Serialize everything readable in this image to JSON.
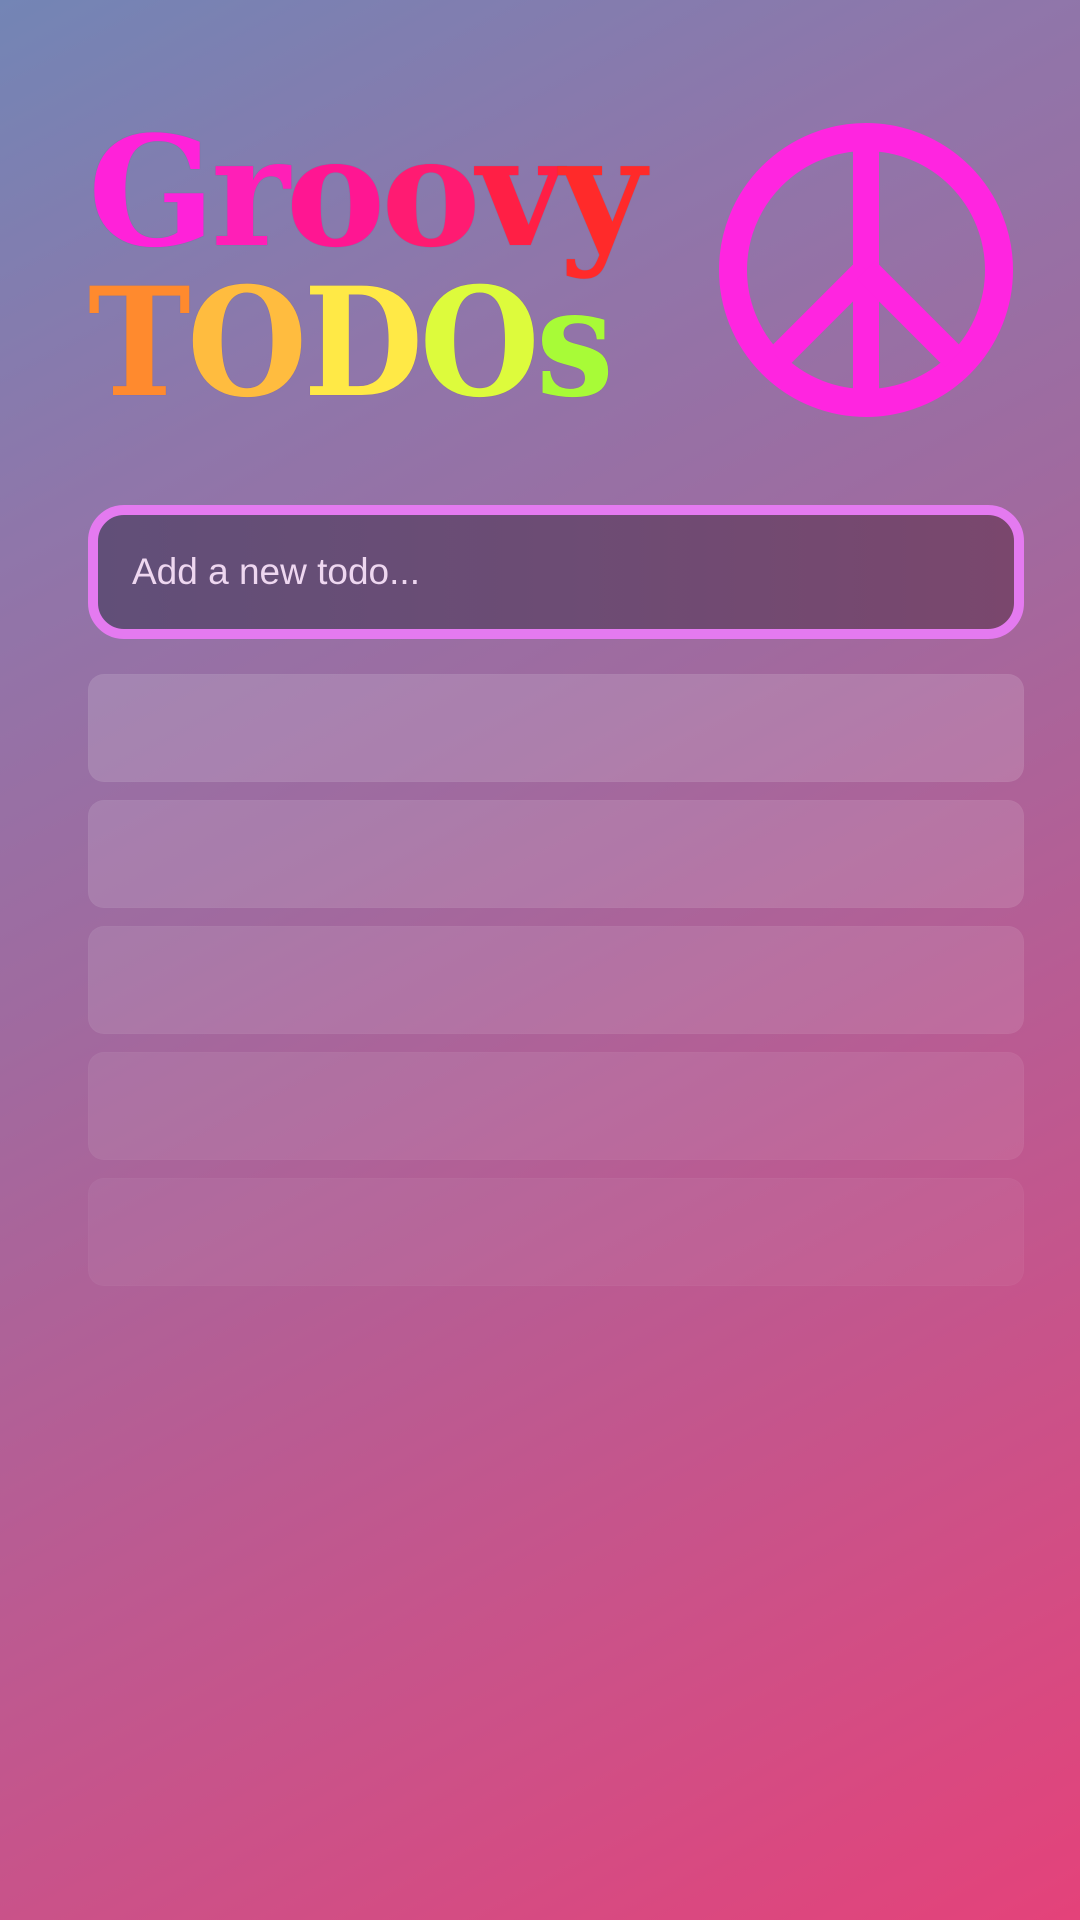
{
  "header": {
    "title_line_1": [
      {
        "char": "G",
        "color": "#ff22d9"
      },
      {
        "char": "r",
        "color": "#ff1fb7"
      },
      {
        "char": "o",
        "color": "#ff1692"
      },
      {
        "char": "o",
        "color": "#ff1b72"
      },
      {
        "char": "v",
        "color": "#ff1f45"
      },
      {
        "char": "y",
        "color": "#ff2a2a"
      }
    ],
    "title_line_2": [
      {
        "char": "T",
        "color": "#ff8a2e"
      },
      {
        "char": "O",
        "color": "#ffbc3f"
      },
      {
        "char": "D",
        "color": "#ffe946"
      },
      {
        "char": "O",
        "color": "#ddfb3c"
      },
      {
        "char": "s",
        "color": "#a8fb37"
      }
    ],
    "peace_icon": "peace-sign-icon",
    "peace_color": "#ff25e0"
  },
  "todo_input": {
    "placeholder": "Add a new todo..."
  },
  "todo_list": {
    "items": [
      "",
      "",
      "",
      "",
      ""
    ]
  }
}
